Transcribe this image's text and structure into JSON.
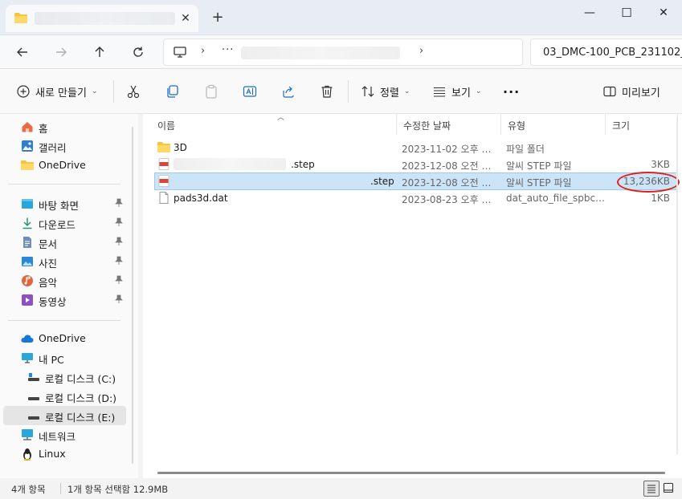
{
  "window": {
    "tab_close_glyph": "✕",
    "new_tab_glyph": "+",
    "minimize_glyph": "—",
    "maximize_glyph": "☐",
    "close_glyph": "✕"
  },
  "address": {
    "more_glyph": "···",
    "chevron_glyph": "›",
    "search_text": "03_DMC-100_PCB_231102_"
  },
  "toolbar": {
    "new_label": "새로 만들기",
    "sort_label": "정렬",
    "view_label": "보기",
    "more_glyph": "···",
    "preview_label": "미리보기"
  },
  "sidebar": {
    "items": [
      {
        "label": "홈",
        "icon": "home-icon"
      },
      {
        "label": "갤러리",
        "icon": "gallery-icon"
      },
      {
        "label": "OneDrive",
        "icon": "folder-icon"
      },
      {
        "label": "바탕 화면",
        "icon": "desktop-icon"
      },
      {
        "label": "다운로드",
        "icon": "download-icon"
      },
      {
        "label": "문서",
        "icon": "document-icon"
      },
      {
        "label": "사진",
        "icon": "pictures-icon"
      },
      {
        "label": "음악",
        "icon": "music-icon"
      },
      {
        "label": "동영상",
        "icon": "video-icon"
      },
      {
        "label": "OneDrive",
        "icon": "cloud-icon"
      },
      {
        "label": "내 PC",
        "icon": "pc-icon"
      },
      {
        "label": "로컬 디스크 (C:)",
        "icon": "drive-icon"
      },
      {
        "label": "로컬 디스크 (D:)",
        "icon": "drive-icon"
      },
      {
        "label": "로컬 디스크 (E:)",
        "icon": "drive-icon"
      },
      {
        "label": "네트워크",
        "icon": "network-icon"
      },
      {
        "label": "Linux",
        "icon": "linux-icon"
      }
    ]
  },
  "columns": {
    "name": "이름",
    "date": "수정한 날짜",
    "type": "유형",
    "size": "크기"
  },
  "files": [
    {
      "name": "3D",
      "date": "2023-11-02 오후 1...",
      "type": "파일 폴더",
      "size": "",
      "icon": "folder-icon"
    },
    {
      "name": ".step",
      "date": "2023-12-08 오전 9...",
      "type": "알씨 STEP 파일",
      "size": "3KB",
      "icon": "step-file-icon"
    },
    {
      "name": ".step",
      "date": "2023-12-08 오전 9...",
      "type": "알씨 STEP 파일",
      "size": "13,236KB",
      "icon": "step-file-icon"
    },
    {
      "name": "pads3d.dat",
      "date": "2023-08-23 오후 3...",
      "type": "dat_auto_file_spbcdns",
      "size": "1KB",
      "icon": "file-icon"
    }
  ],
  "status": {
    "item_count": "4개 항목",
    "selection": "1개 항목 선택함 12.9MB"
  },
  "colors": {
    "selection": "#cce4f7",
    "highlight_circle": "#e02020",
    "folder": "#f4c542"
  }
}
